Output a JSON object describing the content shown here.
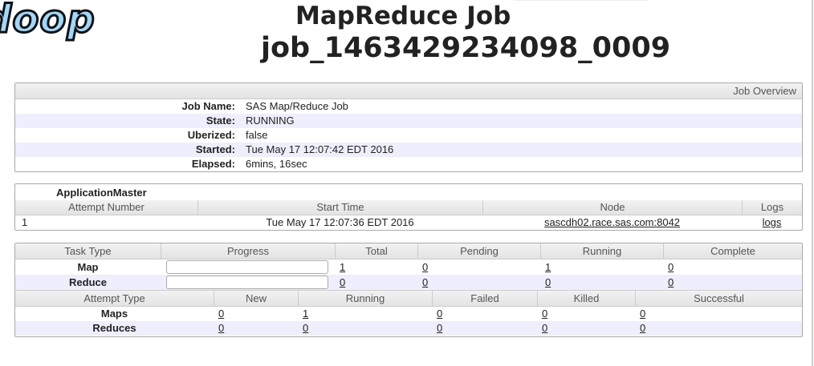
{
  "logo": "doop",
  "title": "MapReduce Job",
  "job_id": "job_1463429234098_0009",
  "overview": {
    "header": "Job Overview",
    "rows": [
      {
        "label": "Job Name:",
        "value": "SAS Map/Reduce Job"
      },
      {
        "label": "State:",
        "value": "RUNNING"
      },
      {
        "label": "Uberized:",
        "value": "false"
      },
      {
        "label": "Started:",
        "value": "Tue May 17 12:07:42 EDT 2016"
      },
      {
        "label": "Elapsed:",
        "value": "6mins, 16sec"
      }
    ]
  },
  "am": {
    "title": "ApplicationMaster",
    "headers": [
      "Attempt Number",
      "Start Time",
      "Node",
      "Logs"
    ],
    "row": {
      "attempt": "1",
      "start": "Tue May 17 12:07:36 EDT 2016",
      "node": "sascdh02.race.sas.com:8042",
      "logs": "logs"
    }
  },
  "tasks": {
    "headers": [
      "Task Type",
      "Progress",
      "Total",
      "Pending",
      "Running",
      "Complete"
    ],
    "rows": [
      {
        "type": "Map",
        "progress": 0,
        "total": "1",
        "pending": "0",
        "running": "1",
        "complete": "0"
      },
      {
        "type": "Reduce",
        "progress": 0,
        "total": "0",
        "pending": "0",
        "running": "0",
        "complete": "0"
      }
    ]
  },
  "attempts": {
    "headers": [
      "Attempt Type",
      "New",
      "Running",
      "Failed",
      "Killed",
      "Successful"
    ],
    "rows": [
      {
        "type": "Maps",
        "new": "0",
        "running": "1",
        "failed": "0",
        "killed": "0",
        "successful": "0"
      },
      {
        "type": "Reduces",
        "new": "0",
        "running": "0",
        "failed": "0",
        "killed": "0",
        "successful": "0"
      }
    ]
  }
}
